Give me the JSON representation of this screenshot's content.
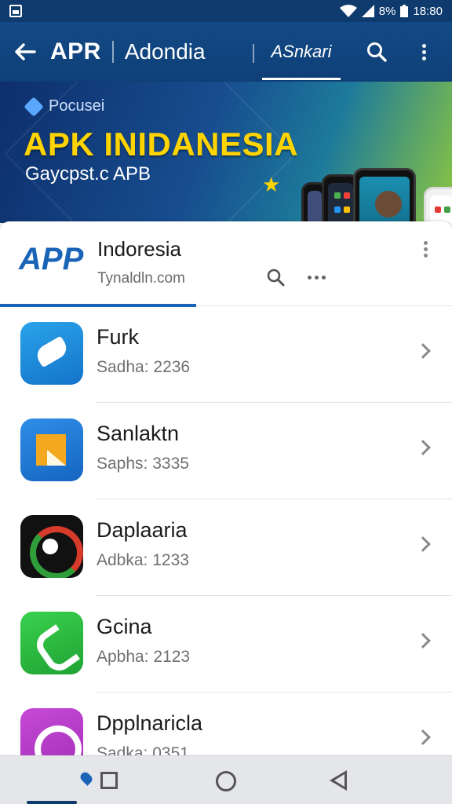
{
  "status_bar": {
    "battery": "8%",
    "time": "18:80"
  },
  "app_bar": {
    "title": "APR",
    "subtitle": "Adondia",
    "active_tab": "ASnkari"
  },
  "banner": {
    "tag": "Pocusei",
    "title": "APK INIDANESIA",
    "subtitle": "Gaycpst.c APB"
  },
  "card": {
    "logo": "APP",
    "title": "Indoresia",
    "domain": "Tynaldln.com"
  },
  "apps": [
    {
      "name": "Furk",
      "meta": "Sadha: 2236",
      "icon": "app-icon-blue"
    },
    {
      "name": "Sanlaktn",
      "meta": "Saphs: 3335",
      "icon": "app-icon-yellow"
    },
    {
      "name": "Daplaaria",
      "meta": "Adbka: 1233",
      "icon": "app-icon-dark"
    },
    {
      "name": "Gcina",
      "meta": "Apbha: 2123",
      "icon": "app-icon-green"
    },
    {
      "name": "Dpplnaricla",
      "meta": "Sadka: 0351",
      "icon": "app-icon-purple"
    }
  ],
  "colors": {
    "app_bar": "#124a86",
    "banner_title": "#ffd400",
    "accent": "#1a64b8"
  }
}
